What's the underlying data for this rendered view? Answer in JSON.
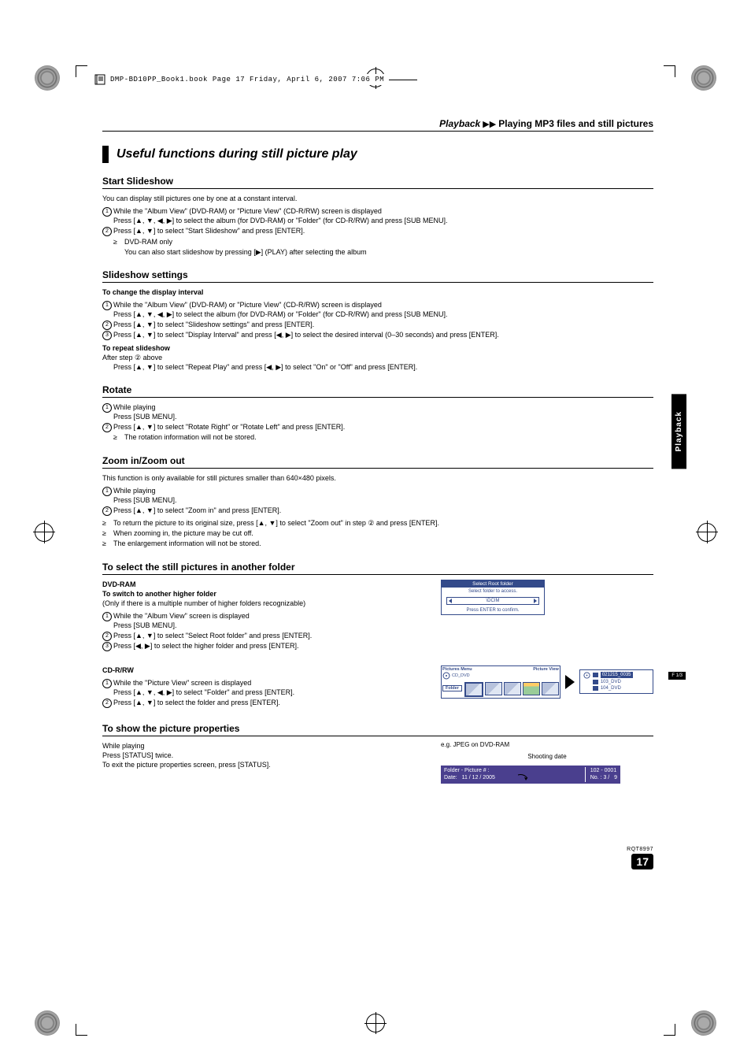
{
  "header_pdf": "DMP-BD10PP_Book1.book  Page 17  Friday, April 6, 2007  7:06 PM",
  "section_header": {
    "bold": "Playback",
    "arrows": "▶▶",
    "rest": "Playing MP3 files and still pictures"
  },
  "h1": "Useful functions during still picture play",
  "side_tab": "Playback",
  "start_slideshow": {
    "title": "Start Slideshow",
    "intro": "You can display still pictures one by one at a constant interval.",
    "s1a": "While the \"Album View\" (DVD-RAM) or \"Picture View\" (CD-R/RW) screen is displayed",
    "s1b": "Press [▲, ▼, ◀, ▶] to select the album (for DVD-RAM) or \"Folder\" (for CD-R/RW) and press [SUB MENU].",
    "s2a": "Press [▲, ▼] to select \"Start Slideshow\" and press [ENTER].",
    "s2b": "DVD-RAM only",
    "s2c": "You can also start slideshow by pressing [▶] (PLAY) after selecting the album"
  },
  "slideshow_settings": {
    "title": "Slideshow settings",
    "sub1": "To change the display interval",
    "s1a": "While the \"Album View\" (DVD-RAM) or \"Picture View\" (CD-R/RW) screen is displayed",
    "s1b": "Press [▲, ▼, ◀, ▶] to select the album (for DVD-RAM) or \"Folder\" (for CD-R/RW) and press [SUB MENU].",
    "s2": "Press [▲, ▼] to select \"Slideshow settings\" and press [ENTER].",
    "s3": "Press [▲, ▼] to select \"Display Interval\" and press [◀, ▶] to select the desired interval (0–30 seconds) and press [ENTER].",
    "sub2": "To repeat slideshow",
    "r1": "After step ② above",
    "r2": "Press [▲, ▼] to select \"Repeat Play\" and press [◀, ▶] to select \"On\" or \"Off\" and press [ENTER]."
  },
  "rotate": {
    "title": "Rotate",
    "s1a": "While playing",
    "s1b": "Press [SUB MENU].",
    "s2a": "Press [▲, ▼] to select \"Rotate Right\" or \"Rotate Left\" and press [ENTER].",
    "s2b": "The rotation information will not be stored."
  },
  "zoom": {
    "title": "Zoom in/Zoom out",
    "intro": "This function is only available for still pictures smaller than 640×480 pixels.",
    "s1a": "While playing",
    "s1b": "Press [SUB MENU].",
    "s2": "Press [▲, ▼] to select \"Zoom in\" and press [ENTER].",
    "b1": "To return the picture to its original size, press [▲, ▼] to select \"Zoom out\" in step ② and press [ENTER].",
    "b2": "When zooming in, the picture may be cut off.",
    "b3": "The enlargement information will not be stored."
  },
  "another_folder": {
    "title": "To select the still pictures in another folder",
    "dvd_ram": "DVD-RAM",
    "sub1": "To switch to another higher folder",
    "intro": "(Only if there is a multiple number of higher folders recognizable)",
    "s1a": "While the \"Album View\" screen is displayed",
    "s1b": "Press [SUB MENU].",
    "s2": "Press [▲, ▼] to select \"Select Root folder\" and press [ENTER].",
    "s3": "Press [◀, ▶] to select the higher folder and press [ENTER].",
    "cd_rrw": "CD-R/RW",
    "c1a": "While the \"Picture View\" screen is displayed",
    "c1b": "Press [▲, ▼, ◀, ▶] to select \"Folder\" and press [ENTER].",
    "c2": "Press [▲, ▼] to select the folder and press [ENTER]."
  },
  "root_ui": {
    "title": "Select Root folder",
    "line1": "Select folder to access.",
    "dcim": "\\DCIM",
    "line2": "Press ENTER to confirm."
  },
  "tree_ui": {
    "pm": "Pictures Menu",
    "pv": "Picture View",
    "cd": "CD_DVD",
    "folder_btn": "Folder",
    "f1": "021215_0035",
    "f2": "103_DVD",
    "f3": "104_DVD",
    "badge": "F  1/3"
  },
  "props": {
    "title": "To show the picture properties",
    "l1": "While playing",
    "l2": "Press [STATUS] twice.",
    "l3": "To exit the picture properties screen, press [STATUS].",
    "eg": "e.g. JPEG on DVD-RAM",
    "shooting": "Shooting date",
    "box_folder": "Folder - Picture # :",
    "box_date": "Date:",
    "box_date_val": "11 / 12 / 2005",
    "box_pic": "102 - 0001",
    "box_no": "No. :  3 /",
    "box_total": "9"
  },
  "footer": {
    "rqt": "RQT8997",
    "page": "17"
  }
}
